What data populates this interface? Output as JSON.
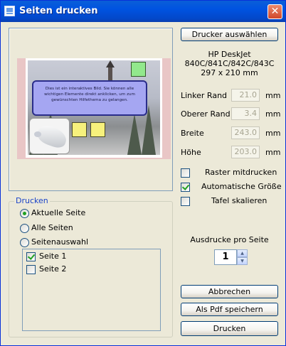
{
  "window": {
    "title": "Seiten drucken",
    "close_label": "✕"
  },
  "preview": {
    "info_text": "Dies ist ein interaktives Bild. Sie können alle wichtigen Elemente direkt anklicken, um zum gewünschten Hilfethema zu gelangen."
  },
  "drucken": {
    "legend": "Drucken",
    "options": [
      "Aktuelle Seite",
      "Alle Seiten",
      "Seitenauswahl"
    ],
    "selected_option": "Aktuelle Seite",
    "pages": [
      {
        "label": "Seite 1",
        "checked": true
      },
      {
        "label": "Seite 2",
        "checked": false
      }
    ]
  },
  "printer": {
    "select_label": "Drucker auswählen",
    "name_line1": "HP DeskJet",
    "name_line2": "840C/841C/842C/843C",
    "paper_size": "297 x 210 mm"
  },
  "margins": {
    "left_label": "Linker Rand",
    "left_value": "21.0",
    "top_label": "Oberer Rand",
    "top_value": "3.4",
    "width_label": "Breite",
    "width_value": "243.0",
    "height_label": "Höhe",
    "height_value": "203.0",
    "unit": "mm"
  },
  "options": {
    "raster_label": "Raster mitdrucken",
    "raster_checked": false,
    "autosize_label": "Automatische Größe",
    "autosize_checked": true,
    "tafel_label": "Tafel skalieren",
    "tafel_checked": false
  },
  "pages_per_sheet": {
    "label": "Ausdrucke pro Seite",
    "value": "1"
  },
  "actions": {
    "cancel_label": "Abbrechen",
    "pdf_label": "Als Pdf speichern",
    "print_label": "Drucken"
  },
  "colors": {
    "title_bar": "#0053e1",
    "close_button": "#d1472a",
    "group_legend": "#1a43c8",
    "check_mark": "#21a121"
  }
}
